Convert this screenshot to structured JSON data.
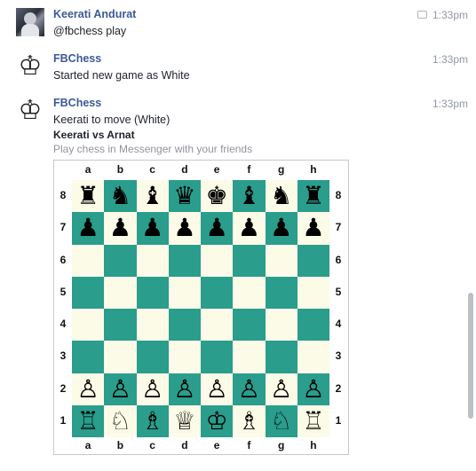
{
  "messages": [
    {
      "sender": "Keerati Andurat",
      "time": "1:33pm",
      "text": "@fbchess play",
      "avatar": "user-photo"
    },
    {
      "sender": "FBChess",
      "time": "1:33pm",
      "text": "Started new game as White",
      "avatar": "king-icon"
    },
    {
      "sender": "FBChess",
      "time": "1:33pm",
      "text": "Keerati to move (White)",
      "avatar": "king-icon",
      "game_title": "Keerati vs Arnat",
      "subtitle": "Play chess in Messenger with your friends"
    }
  ],
  "board": {
    "files": [
      "a",
      "b",
      "c",
      "d",
      "e",
      "f",
      "g",
      "h"
    ],
    "ranks": [
      "8",
      "7",
      "6",
      "5",
      "4",
      "3",
      "2",
      "1"
    ],
    "position": [
      [
        "♜",
        "♞",
        "♝",
        "♛",
        "♚",
        "♝",
        "♞",
        "♜"
      ],
      [
        "♟",
        "♟",
        "♟",
        "♟",
        "♟",
        "♟",
        "♟",
        "♟"
      ],
      [
        "",
        "",
        "",
        "",
        "",
        "",
        "",
        ""
      ],
      [
        "",
        "",
        "",
        "",
        "",
        "",
        "",
        ""
      ],
      [
        "",
        "",
        "",
        "",
        "",
        "",
        "",
        ""
      ],
      [
        "",
        "",
        "",
        "",
        "",
        "",
        "",
        ""
      ],
      [
        "♙",
        "♙",
        "♙",
        "♙",
        "♙",
        "♙",
        "♙",
        "♙"
      ],
      [
        "♖",
        "♘",
        "♗",
        "♕",
        "♔",
        "♗",
        "♘",
        "♖"
      ]
    ],
    "light_color": "#fcfbe7",
    "dark_color": "#2a9d8c"
  },
  "colors": {
    "name": "#3b5998",
    "timestamp": "#9197a3"
  }
}
